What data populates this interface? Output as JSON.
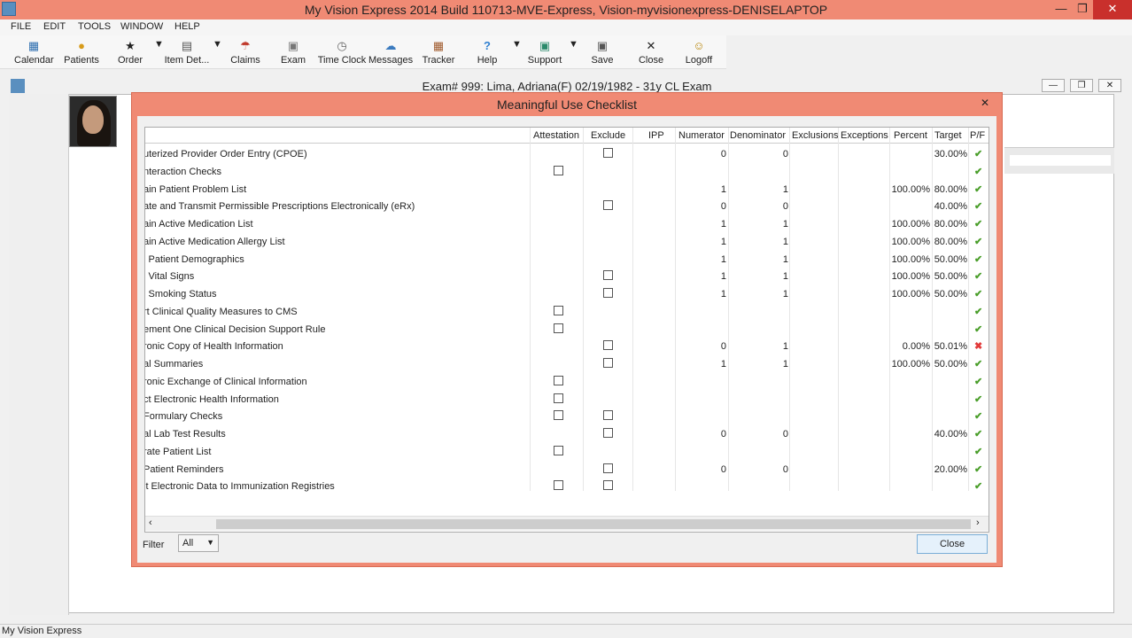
{
  "app": {
    "title": "My Vision Express 2014 Build 110713-MVE-Express, Vision-myvisionexpress-DENISELAPTOP"
  },
  "menu": [
    "FILE",
    "EDIT",
    "TOOLS",
    "WINDOW",
    "HELP"
  ],
  "toolbar": [
    {
      "label": "Calendar",
      "icon": "calendar-icon"
    },
    {
      "label": "Patients",
      "icon": "patients-icon"
    },
    {
      "label": "Order",
      "icon": "order-icon"
    },
    {
      "label": "Item Det...",
      "icon": "item-detail-icon"
    },
    {
      "label": "Claims",
      "icon": "claims-icon"
    },
    {
      "label": "Exam",
      "icon": "exam-icon"
    },
    {
      "label": "Time Clock",
      "icon": "clock-icon"
    },
    {
      "label": "Messages",
      "icon": "messages-icon"
    },
    {
      "label": "Tracker",
      "icon": "tracker-icon"
    },
    {
      "label": "Help",
      "icon": "help-icon"
    },
    {
      "label": "Support",
      "icon": "support-icon"
    },
    {
      "label": "Save",
      "icon": "save-icon"
    },
    {
      "label": "Close",
      "icon": "close-icon"
    },
    {
      "label": "Logoff",
      "icon": "logoff-icon"
    }
  ],
  "exam_window": {
    "title": "Exam# 999:  Lima, Adriana(F) 02/19/1982 - 31y CL Exam"
  },
  "dialog": {
    "title": "Meaningful Use Checklist",
    "close_label": "Close",
    "filter_label": "Filter",
    "filter_value": "All",
    "columns": [
      "Attestation",
      "Exclude",
      "IPP",
      "Numerator",
      "Denominator",
      "Exclusions",
      "Exceptions",
      "Percent",
      "Target",
      "P/F"
    ],
    "rows": [
      {
        "name": "uterized Provider Order Entry (CPOE)",
        "attestation": false,
        "exclude": true,
        "numerator": "0",
        "denominator": "0",
        "percent": "",
        "target": "30.00%",
        "pf": "pass"
      },
      {
        "name": "nteraction Checks",
        "attestation": true,
        "exclude": false,
        "numerator": "",
        "denominator": "",
        "percent": "",
        "target": "",
        "pf": "pass"
      },
      {
        "name": "ain Patient Problem List",
        "attestation": false,
        "exclude": false,
        "numerator": "1",
        "denominator": "1",
        "percent": "100.00%",
        "target": "80.00%",
        "pf": "pass"
      },
      {
        "name": "ate and Transmit Permissible Prescriptions Electronically (eRx)",
        "attestation": false,
        "exclude": true,
        "numerator": "0",
        "denominator": "0",
        "percent": "",
        "target": "40.00%",
        "pf": "pass"
      },
      {
        "name": "ain Active Medication List",
        "attestation": false,
        "exclude": false,
        "numerator": "1",
        "denominator": "1",
        "percent": "100.00%",
        "target": "80.00%",
        "pf": "pass"
      },
      {
        "name": "ain Active Medication Allergy List",
        "attestation": false,
        "exclude": false,
        "numerator": "1",
        "denominator": "1",
        "percent": "100.00%",
        "target": "80.00%",
        "pf": "pass"
      },
      {
        "name": "l Patient Demographics",
        "attestation": false,
        "exclude": false,
        "numerator": "1",
        "denominator": "1",
        "percent": "100.00%",
        "target": "50.00%",
        "pf": "pass"
      },
      {
        "name": "l Vital Signs",
        "attestation": false,
        "exclude": true,
        "numerator": "1",
        "denominator": "1",
        "percent": "100.00%",
        "target": "50.00%",
        "pf": "pass"
      },
      {
        "name": "l Smoking Status",
        "attestation": false,
        "exclude": true,
        "numerator": "1",
        "denominator": "1",
        "percent": "100.00%",
        "target": "50.00%",
        "pf": "pass"
      },
      {
        "name": "rt Clinical Quality Measures to CMS",
        "attestation": true,
        "exclude": false,
        "numerator": "",
        "denominator": "",
        "percent": "",
        "target": "",
        "pf": "pass"
      },
      {
        "name": "ement One Clinical Decision Support Rule",
        "attestation": true,
        "exclude": false,
        "numerator": "",
        "denominator": "",
        "percent": "",
        "target": "",
        "pf": "pass"
      },
      {
        "name": "ronic Copy of Health Information",
        "attestation": false,
        "exclude": true,
        "numerator": "0",
        "denominator": "1",
        "percent": "0.00%",
        "target": "50.01%",
        "pf": "fail"
      },
      {
        "name": "al Summaries",
        "attestation": false,
        "exclude": true,
        "numerator": "1",
        "denominator": "1",
        "percent": "100.00%",
        "target": "50.00%",
        "pf": "pass"
      },
      {
        "name": "ronic Exchange of Clinical Information",
        "attestation": true,
        "exclude": false,
        "numerator": "",
        "denominator": "",
        "percent": "",
        "target": "",
        "pf": "pass"
      },
      {
        "name": "ct Electronic Health Information",
        "attestation": true,
        "exclude": false,
        "numerator": "",
        "denominator": "",
        "percent": "",
        "target": "",
        "pf": "pass"
      },
      {
        "name": "Formulary Checks",
        "attestation": true,
        "exclude": true,
        "numerator": "",
        "denominator": "",
        "percent": "",
        "target": "",
        "pf": "pass"
      },
      {
        "name": "al Lab Test Results",
        "attestation": false,
        "exclude": true,
        "numerator": "0",
        "denominator": "0",
        "percent": "",
        "target": "40.00%",
        "pf": "pass"
      },
      {
        "name": "rate Patient List",
        "attestation": true,
        "exclude": false,
        "numerator": "",
        "denominator": "",
        "percent": "",
        "target": "",
        "pf": "pass"
      },
      {
        "name": "Patient Reminders",
        "attestation": false,
        "exclude": true,
        "numerator": "0",
        "denominator": "0",
        "percent": "",
        "target": "20.00%",
        "pf": "pass"
      },
      {
        "name": "it Electronic Data to Immunization Registries",
        "attestation": true,
        "exclude": true,
        "numerator": "",
        "denominator": "",
        "percent": "",
        "target": "",
        "pf": "pass"
      }
    ]
  },
  "status": {
    "text": "My Vision Express"
  },
  "colors": {
    "title_accent": "#f08a74",
    "pass": "#4a9e2a",
    "fail": "#e23a3a"
  }
}
